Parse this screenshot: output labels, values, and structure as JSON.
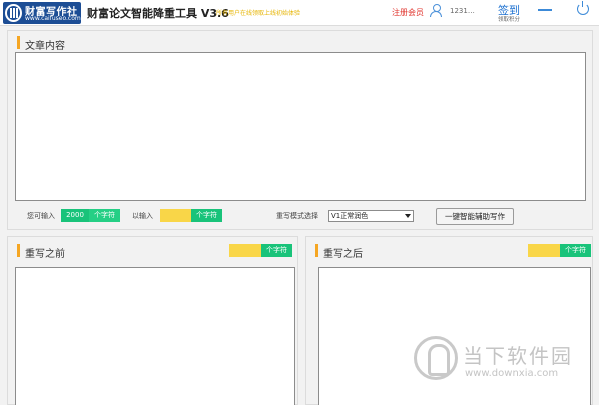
{
  "header": {
    "logo_name": "财富写作社",
    "logo_url": "www.caifuseo.com",
    "app_title": "财富论文智能降重工具 V3.6",
    "notice": "所有用户在线领取上线初始体验",
    "register_label": "注册会员",
    "user_id": "1231…",
    "signin_label": "签到",
    "signin_sub": "领取积分"
  },
  "article": {
    "title": "文章内容",
    "content": "",
    "can_input_label": "您可输入",
    "can_input_value": "2000",
    "unit": "个字符",
    "input_label": "以输入",
    "input_value": "",
    "mode_label": "重写模式选择",
    "mode_selected": "V1正常润色",
    "assist_button": "一键智能辅助写作"
  },
  "before": {
    "title": "重写之前",
    "count": "",
    "unit": "个字符",
    "content": ""
  },
  "after": {
    "title": "重写之后",
    "count": "",
    "unit": "个字符",
    "content": ""
  },
  "watermark": {
    "text": "当下软件园",
    "url": "www.downxia.com"
  },
  "colors": {
    "accent_bar": "#f5a623",
    "count_green": "#19c37a",
    "count_yellow": "#f9d648",
    "logo_bg": "#1c4d95",
    "register": "#e0322b",
    "signin": "#1a6fd0"
  }
}
